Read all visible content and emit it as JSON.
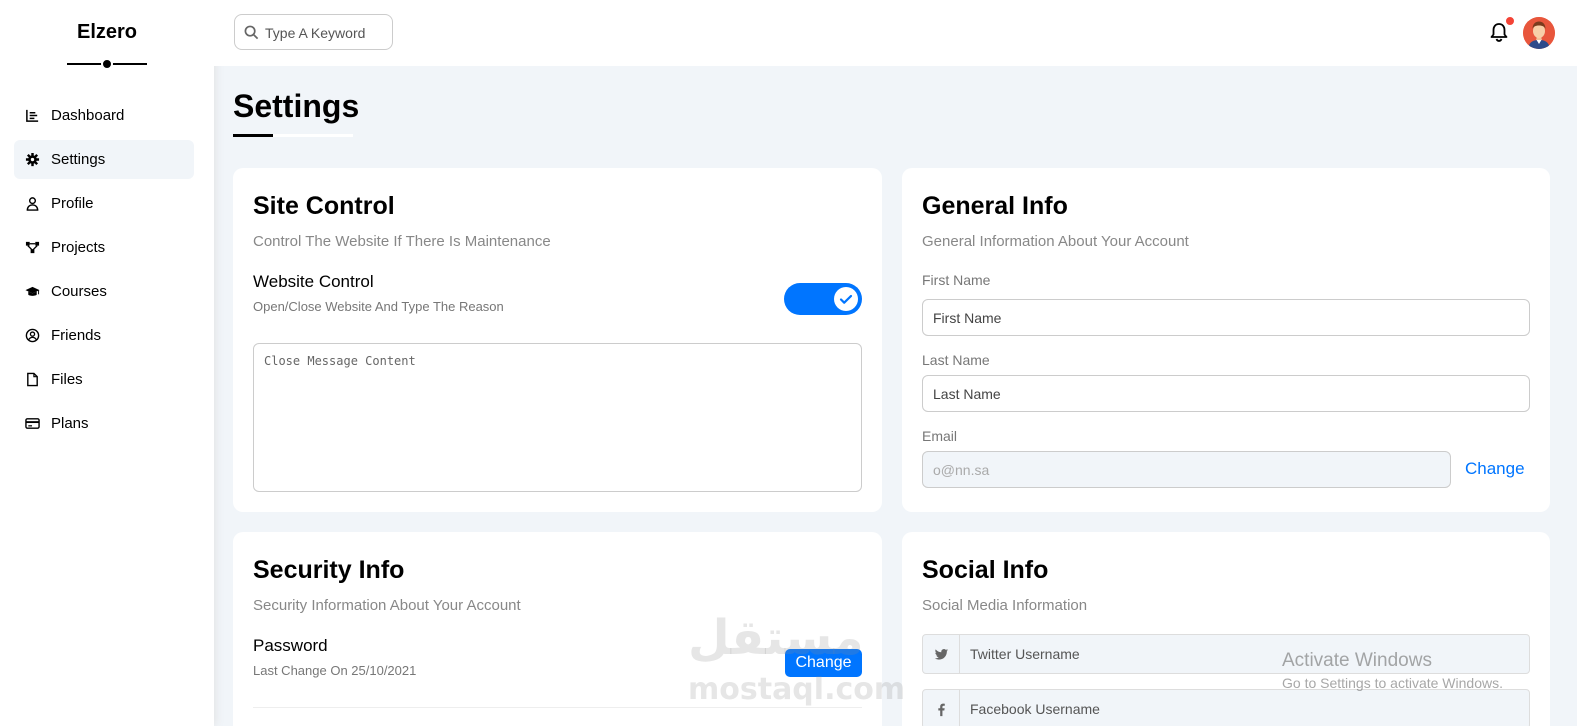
{
  "brand": {
    "name": "Elzero"
  },
  "sidebar": {
    "items": [
      {
        "label": "Dashboard",
        "icon": "chart-icon",
        "active": false
      },
      {
        "label": "Settings",
        "icon": "gear-icon",
        "active": true
      },
      {
        "label": "Profile",
        "icon": "user-icon",
        "active": false
      },
      {
        "label": "Projects",
        "icon": "diagram-icon",
        "active": false
      },
      {
        "label": "Courses",
        "icon": "graduation-cap-icon",
        "active": false
      },
      {
        "label": "Friends",
        "icon": "user-circle-icon",
        "active": false
      },
      {
        "label": "Files",
        "icon": "file-icon",
        "active": false
      },
      {
        "label": "Plans",
        "icon": "credit-card-icon",
        "active": false
      }
    ]
  },
  "header": {
    "search": {
      "placeholder": "Type A Keyword",
      "icon": "search-icon"
    },
    "notification_icon": "bell-icon",
    "colors": {
      "notification_dot": "#f44336"
    }
  },
  "page": {
    "title": "Settings"
  },
  "site_control": {
    "title": "Site Control",
    "subtitle": "Control The Website If There Is Maintenance",
    "website_control": {
      "label": "Website Control",
      "description": "Open/Close Website And Type The Reason",
      "enabled": true
    },
    "message": {
      "placeholder": "Close Message Content"
    }
  },
  "general_info": {
    "title": "General Info",
    "subtitle": "General Information About Your Account",
    "first_name": {
      "label": "First Name",
      "placeholder": "First Name"
    },
    "last_name": {
      "label": "Last Name",
      "placeholder": "Last Name"
    },
    "email": {
      "label": "Email",
      "placeholder": "o@nn.sa",
      "change_label": "Change"
    }
  },
  "security_info": {
    "title": "Security Info",
    "subtitle": "Security Information About Your Account",
    "password": {
      "label": "Password",
      "description": "Last Change On 25/10/2021",
      "button_label": "Change"
    }
  },
  "social_info": {
    "title": "Social Info",
    "subtitle": "Social Media Information",
    "fields": [
      {
        "placeholder": "Twitter Username",
        "icon": "twitter-icon"
      },
      {
        "placeholder": "Facebook Username",
        "icon": "facebook-icon"
      }
    ]
  },
  "overlays": {
    "watermark_arabic": "مستقل",
    "watermark_latin": "mostaql.com",
    "activate_title": "Activate Windows",
    "activate_sub": "Go to Settings to activate Windows."
  },
  "colors": {
    "accent": "#0075ff",
    "background": "#f1f5f9"
  }
}
